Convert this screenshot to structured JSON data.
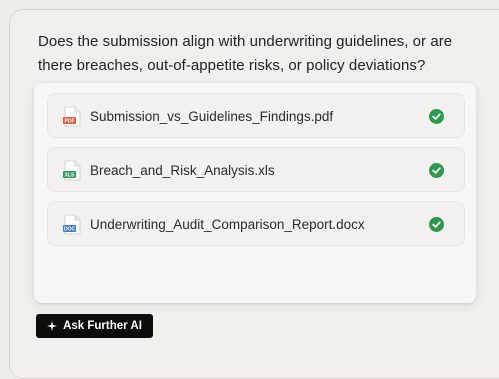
{
  "question": "Does the submission align with underwriting guidelines, or are there breaches, out-of-appetite risks, or policy deviations?",
  "files": [
    {
      "name": "Submission_vs_Guidelines_Findings.pdf",
      "type_label": "PDF",
      "icon": "pdf-file-icon",
      "color": "#e15a3a",
      "status": "check-icon"
    },
    {
      "name": "Breach_and_Risk_Analysis.xls",
      "type_label": "XLS",
      "icon": "excel-file-icon",
      "color": "#2e9a5a",
      "status": "check-icon"
    },
    {
      "name": "Underwriting_Audit_Comparison_Report.docx",
      "type_label": "DOC",
      "icon": "word-file-icon",
      "color": "#3b78d8",
      "status": "check-icon"
    }
  ],
  "success_color": "#2c9a4d",
  "button": {
    "label": "Ask Further AI",
    "icon": "sparkle-icon"
  }
}
